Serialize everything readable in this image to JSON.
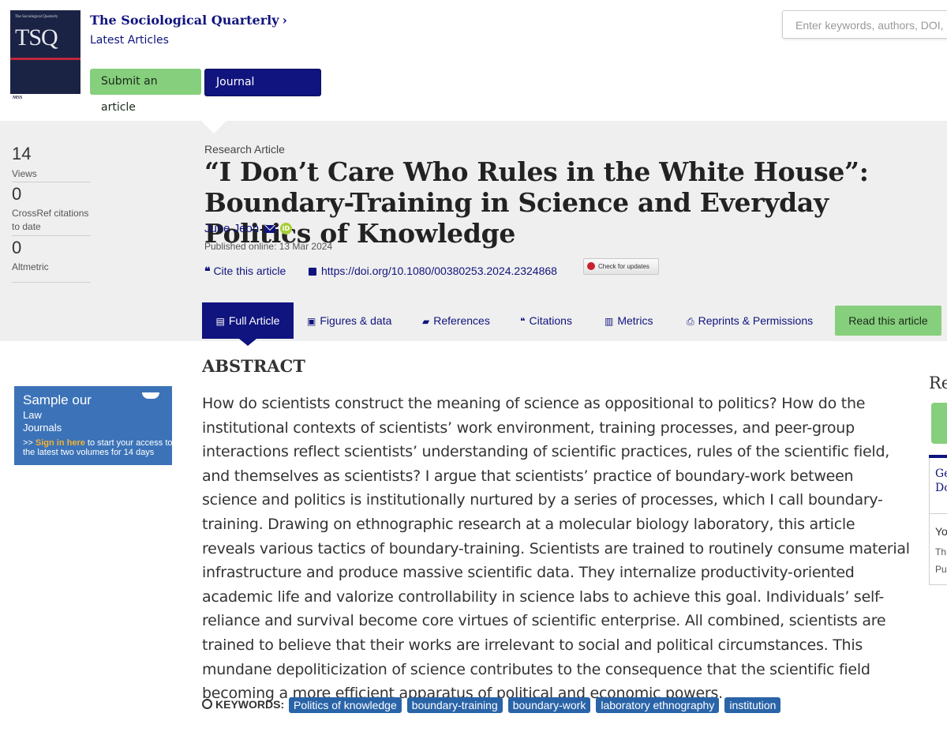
{
  "cover": {
    "small_text": "The Sociological Quarterly",
    "big_text": "TSQ",
    "publisher_mark": "MSS"
  },
  "header": {
    "journal_title": "The Sociological Quarterly",
    "chevron": "›",
    "latest_articles": "Latest Articles",
    "submit_label": "Submit an article",
    "homepage_label": "Journal homepage",
    "search_placeholder": "Enter keywords, authors, DOI, ETC"
  },
  "metrics": [
    {
      "value": "14",
      "label": "Views"
    },
    {
      "value": "0",
      "label": "CrossRef citations to date"
    },
    {
      "value": "0",
      "label": "Altmetric"
    }
  ],
  "article": {
    "type": "Research Article",
    "title": "“I Don’t Care Who Rules in the White House”: Boundary-Training in Science and Everyday Politics of Knowledge",
    "author": "June Jeon",
    "orcid_label": "iD",
    "published": "Published online: 13 Mar 2024",
    "cite_label": "Cite this article",
    "doi": "https://doi.org/10.1080/00380253.2024.2324868",
    "check_updates": "Check for updates"
  },
  "tabs": [
    {
      "icon": "file-icon",
      "label": "Full Article"
    },
    {
      "icon": "image-icon",
      "label": "Figures & data"
    },
    {
      "icon": "book-icon",
      "label": "References"
    },
    {
      "icon": "quote-icon",
      "label": "Citations"
    },
    {
      "icon": "bar-chart-icon",
      "label": "Metrics"
    },
    {
      "icon": "print-icon",
      "label": "Reprints & Permissions"
    }
  ],
  "read_button": "Read this article",
  "abstract": {
    "heading": "ABSTRACT",
    "text": "How do scientists construct the meaning of science as oppositional to politics? How do the institutional contexts of scientists’ work environment, training processes, and peer-group interactions reflect scientists’ understanding of scientific practices, rules of the scientific field, and themselves as scientists? I argue that scientists’ practice of boundary-work between science and politics is institutionally nurtured by a series of processes, which I call boundary-training. Drawing on ethnographic research at a molecular biology laboratory, this article reveals various tactics of boundary-training. Scientists are trained to routinely consume material infrastructure and produce massive scientific data. They internalize productivity-oriented academic life and valorize controllability in science labs to achieve this goal. Individuals’ self-reliance and survival become core virtues of scientific enterprise. All combined, scientists are trained to believe that their works are irrelevant to social and political circumstances. This mundane depoliticization of science contributes to the consequence that the scientific field becoming a more efficient apparatus of political and economic powers."
  },
  "keywords": {
    "label": "KEYWORDS:",
    "items": [
      "Politics of knowledge",
      "boundary-training",
      "boundary-work",
      "laboratory ethnography",
      "institution"
    ]
  },
  "ad": {
    "line1": "Sample our",
    "line2a": "Law",
    "line2b": "Journals",
    "prefix": ">> ",
    "sign_in": "Sign in here",
    "rest": " to start your access to the latest two volumes for 14 days"
  },
  "right_panel": {
    "heading": "Re",
    "t1a": "Ge",
    "t1b": "Do",
    "t2": "Yo",
    "t3a": "Th",
    "t3b": "Pu"
  }
}
